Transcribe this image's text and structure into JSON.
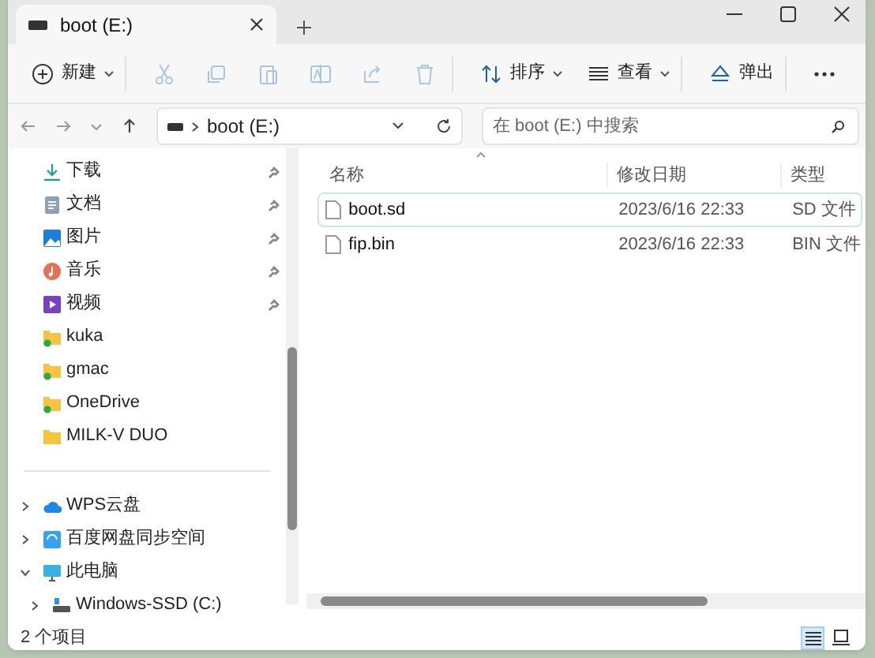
{
  "tab": {
    "title": "boot (E:)"
  },
  "toolbar": [
    {
      "kind": "new",
      "label": "新建",
      "disabled": false
    },
    {
      "kind": "cut",
      "disabled": true
    },
    {
      "kind": "copy",
      "disabled": true
    },
    {
      "kind": "paste",
      "disabled": true
    },
    {
      "kind": "rename",
      "disabled": true
    },
    {
      "kind": "share",
      "disabled": true
    },
    {
      "kind": "delete",
      "disabled": true
    },
    {
      "kind": "sort",
      "label": "排序",
      "disabled": false
    },
    {
      "kind": "view",
      "label": "查看",
      "disabled": false
    },
    {
      "kind": "eject",
      "label": "弹出",
      "disabled": false
    },
    {
      "kind": "more",
      "disabled": false
    }
  ],
  "address": {
    "path": "boot (E:)"
  },
  "search": {
    "placeholder": "在 boot (E:) 中搜索"
  },
  "sidebar": {
    "items": [
      {
        "kind": "download",
        "label": "下载",
        "pinned": true
      },
      {
        "kind": "documents",
        "label": "文档",
        "pinned": true
      },
      {
        "kind": "pictures",
        "label": "图片",
        "pinned": true
      },
      {
        "kind": "music",
        "label": "音乐",
        "pinned": true
      },
      {
        "kind": "videos",
        "label": "视频",
        "pinned": true
      },
      {
        "kind": "synced-folder",
        "label": "kuka",
        "pinned": false
      },
      {
        "kind": "synced-folder",
        "label": "gmac",
        "pinned": false
      },
      {
        "kind": "synced-folder",
        "label": "OneDrive",
        "pinned": false
      },
      {
        "kind": "folder",
        "label": "MILK-V DUO",
        "pinned": false
      },
      {
        "kind": "separator"
      },
      {
        "kind": "cloud",
        "label": "WPS云盘",
        "expanded": false
      },
      {
        "kind": "baidu",
        "label": "百度网盘同步空间",
        "expanded": false
      },
      {
        "kind": "pc",
        "label": "此电脑",
        "expanded": true,
        "children": [
          {
            "kind": "drive",
            "label": "Windows-SSD (C:)",
            "expanded": false
          }
        ]
      }
    ]
  },
  "table": {
    "columns": [
      "名称",
      "修改日期",
      "类型"
    ],
    "rows": [
      {
        "name": "boot.sd",
        "modified": "2023/6/16 22:33",
        "type": "SD 文件",
        "focused": true
      },
      {
        "name": "fip.bin",
        "modified": "2023/6/16 22:33",
        "type": "BIN 文件",
        "focused": false
      }
    ]
  },
  "status_bar": {
    "count": "2 个项目",
    "views": [
      {
        "kind": "details",
        "selected": true
      },
      {
        "kind": "tiles",
        "selected": false
      }
    ]
  }
}
